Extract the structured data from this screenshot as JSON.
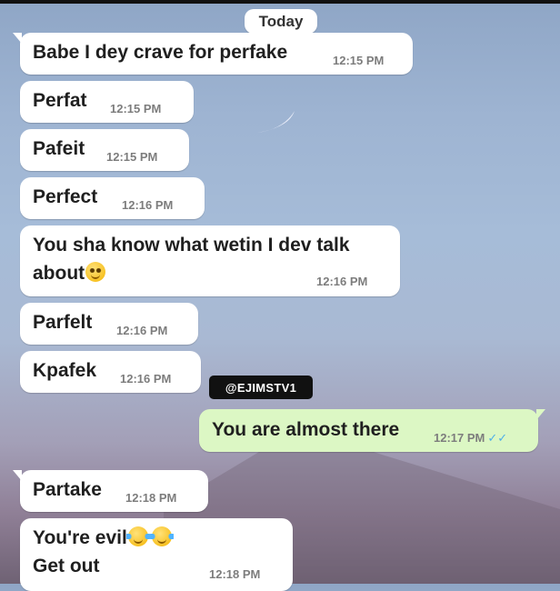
{
  "chat": {
    "date_divider": "Today",
    "messages": [
      {
        "text": "Babe I dey crave for perfake",
        "time": "12:15 PM"
      },
      {
        "text": "Perfat",
        "time": "12:15 PM"
      },
      {
        "text": "Pafeit",
        "time": "12:15 PM"
      },
      {
        "text": "Perfect",
        "time": "12:16 PM"
      },
      {
        "text_line1": "You sha know what wetin I dev talk",
        "text_line2": "about",
        "emoji": "pleading-face-emoji",
        "time": "12:16 PM"
      },
      {
        "text": "Parfelt",
        "time": "12:16 PM"
      },
      {
        "text": "Kpafek",
        "time": "12:16 PM"
      },
      {
        "text": "You are almost there",
        "time": "12:17 PM",
        "status_icon": "double-check-icon",
        "outgoing": true
      },
      {
        "text": "Partake",
        "time": "12:18 PM"
      },
      {
        "text_line1": "You're evil",
        "text_line2": "Get out",
        "emoji": "crying-laughing-emoji",
        "time": "12:18 PM"
      }
    ]
  },
  "watermark": {
    "handle": "@EJIMSTV1"
  },
  "colors": {
    "incoming_bubble": "#ffffff",
    "outgoing_bubble": "#dcf7c4",
    "read_ticks": "#4fb0e8"
  }
}
